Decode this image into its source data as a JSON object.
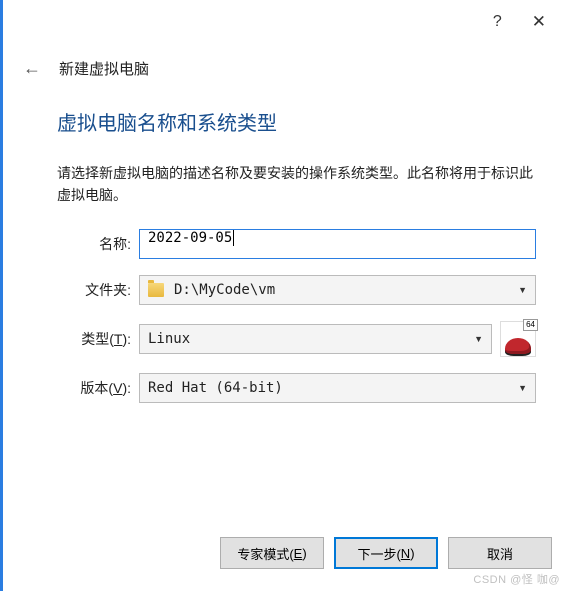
{
  "titlebar": {
    "help": "?",
    "close": "✕"
  },
  "header": {
    "title": "新建虚拟电脑"
  },
  "page": {
    "heading": "虚拟电脑名称和系统类型",
    "description": "请选择新虚拟电脑的描述名称及要安装的操作系统类型。此名称将用于标识此虚拟电脑。"
  },
  "form": {
    "name_label": "名称:",
    "name_value": "2022-09-05",
    "folder_label": "文件夹:",
    "folder_value": "D:\\MyCode\\vm",
    "type_label_pre": "类型(",
    "type_hotkey": "T",
    "type_label_post": "):",
    "type_value": "Linux",
    "version_label_pre": "版本(",
    "version_hotkey": "V",
    "version_label_post": "):",
    "version_value": "Red Hat (64-bit)",
    "os_badge_num": "64"
  },
  "buttons": {
    "expert_pre": "专家模式(",
    "expert_hotkey": "E",
    "expert_post": ")",
    "next_pre": "下一步(",
    "next_hotkey": "N",
    "next_post": ")",
    "cancel": "取消"
  },
  "watermark": "CSDN @怪 咖@"
}
